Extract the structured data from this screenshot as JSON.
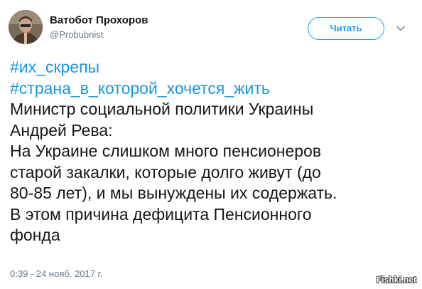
{
  "author": {
    "display_name": "Ватобот Прохоров",
    "handle": "@Probubnist",
    "avatar_icon": "person-photo"
  },
  "follow_button": {
    "label": "Читать"
  },
  "menu_icon": "chevron-down-icon",
  "tweet": {
    "hashtags": [
      "#их_скрепы",
      "#страна_в_которой_хочется_жить"
    ],
    "lines": [
      "Министр социальной политики Украины",
      "Андрей Рева:",
      "На Украине слишком много пенсионеров",
      "старой закалки, которые долго живут (до",
      "80-85 лет), и мы вынуждены их содержать.",
      "В этом причина дефицита Пенсионного",
      "фонда"
    ],
    "timestamp": "0:39 - 24 нояб. 2017 г."
  },
  "watermark": "Fishki.net",
  "colors": {
    "link": "#1b95e0",
    "button": "#1da1f2",
    "secondary_text": "#657786",
    "primary_text": "#14171a"
  }
}
